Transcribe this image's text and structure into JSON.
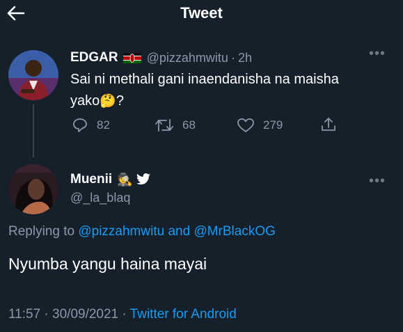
{
  "header": {
    "title": "Tweet",
    "back_icon": "arrow-left-icon"
  },
  "parent_tweet": {
    "display_name": "EDGAR",
    "flag_icon": "kenya-flag-icon",
    "handle": "@pizzahmwitu",
    "separator": "·",
    "time": "2h",
    "text_line1": "Sai ni methali gani inaendanisha na maisha",
    "text_line2": "yako",
    "emoji": "🤔",
    "text_end": "?",
    "replies": "82",
    "retweets": "68",
    "likes": "279"
  },
  "reply_tweet": {
    "display_name": "Muenii",
    "badge_emoji": "🕵",
    "verified_icon": "twitter-bird-icon",
    "handle": "@_la_blaq",
    "replying_prefix": "Replying to",
    "mention1": "@pizzahmwitu",
    "and_text": "and",
    "mention2": "@MrBlackOG",
    "text": "Nyumba yangu haina mayai",
    "time": "11:57",
    "date": "30/09/2021",
    "separator": "·",
    "source": "Twitter for Android"
  },
  "colors": {
    "background": "#15202b",
    "muted": "#8b98a5",
    "link": "#1d9bf0"
  }
}
